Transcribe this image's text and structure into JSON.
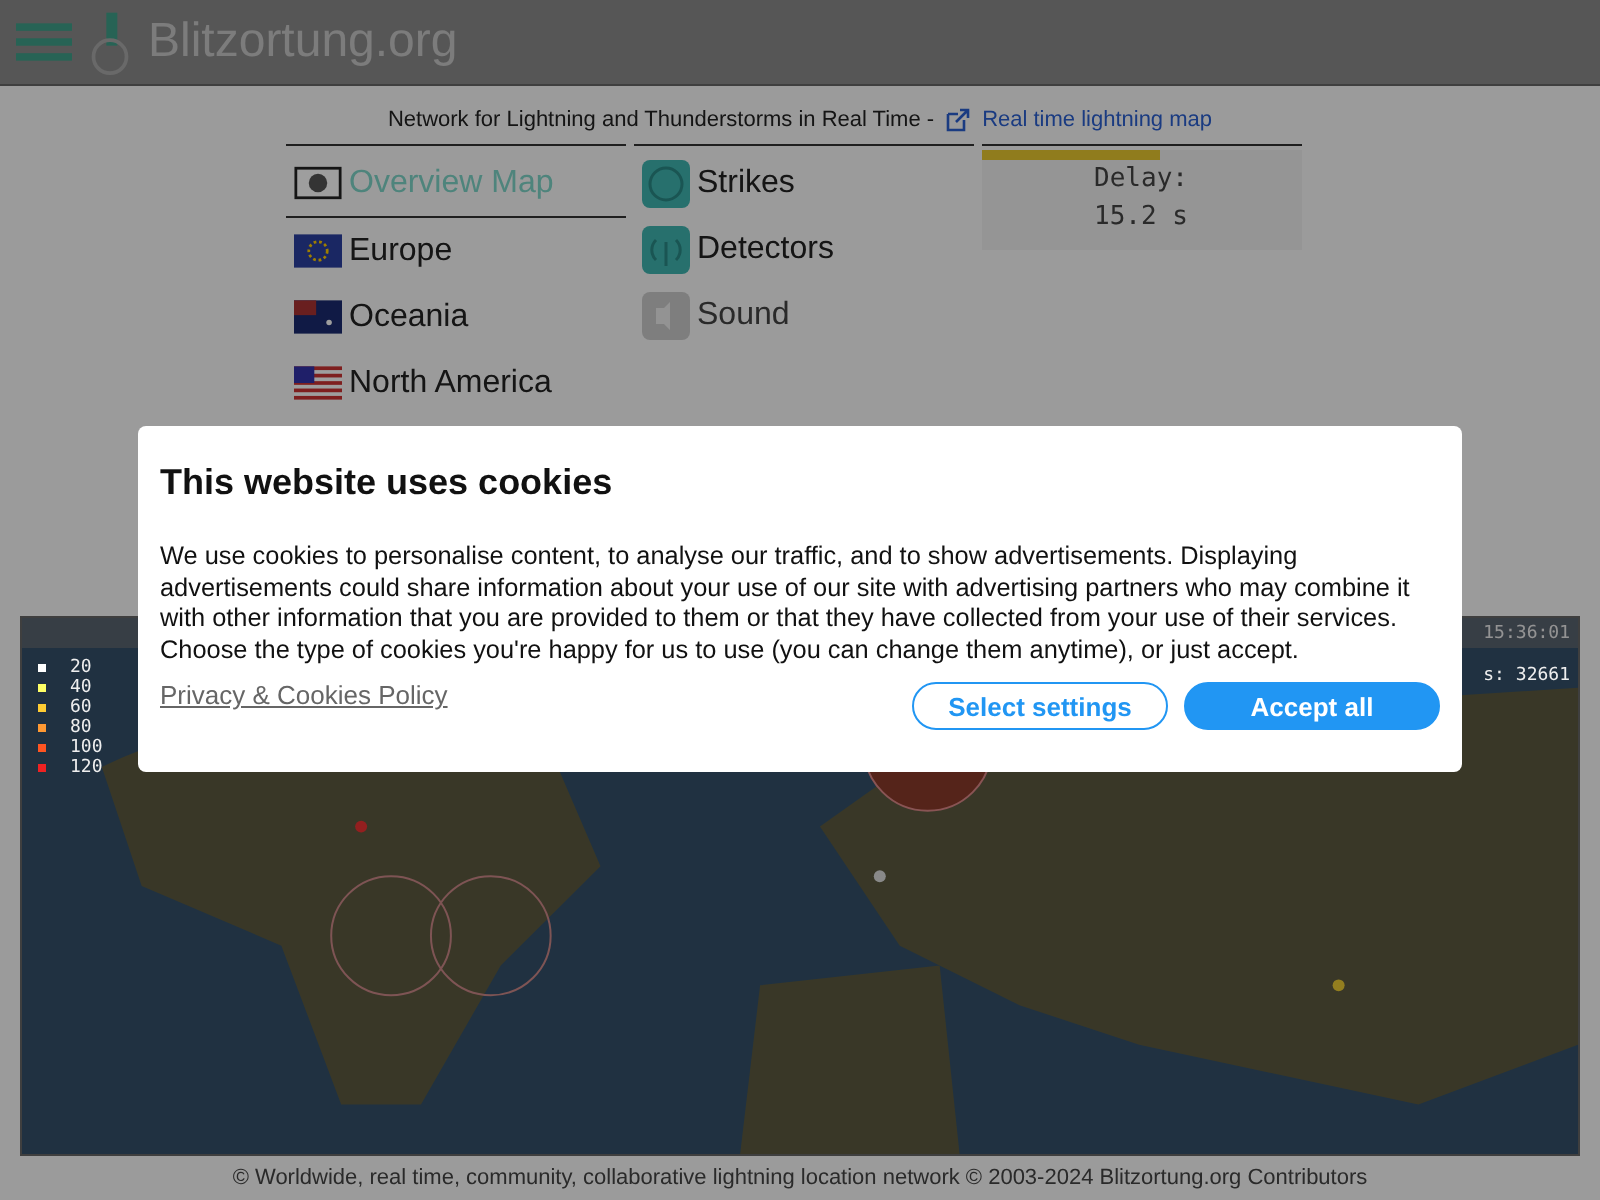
{
  "header": {
    "logo_text": "Blitzortung.org"
  },
  "tagline": {
    "text": "Network for Lightning and Thunderstorms in Real Time -",
    "link": "Real time lightning map"
  },
  "regions": [
    {
      "label": "Overview Map",
      "kind": "globe",
      "selected": true
    },
    {
      "label": "Europe",
      "kind": "eu",
      "selected": false
    },
    {
      "label": "Oceania",
      "kind": "au",
      "selected": false
    },
    {
      "label": "North America",
      "kind": "us",
      "selected": false
    }
  ],
  "features": [
    {
      "label": "Strikes",
      "kind": "strikes",
      "disabled": false
    },
    {
      "label": "Detectors",
      "kind": "detectors",
      "disabled": false
    },
    {
      "label": "Sound",
      "kind": "sound",
      "disabled": true
    }
  ],
  "delay": {
    "label": "Delay:",
    "value": "15.2 s",
    "level": 0.56
  },
  "map": {
    "time": "15:36:01",
    "count": "s: 32661",
    "legend": [
      {
        "label": "20",
        "color": "#ffffff"
      },
      {
        "label": "40",
        "color": "#ffff66"
      },
      {
        "label": "60",
        "color": "#ffcc33"
      },
      {
        "label": "80",
        "color": "#ff9933"
      },
      {
        "label": "100",
        "color": "#ff5522"
      },
      {
        "label": "120",
        "color": "#ee2222"
      }
    ]
  },
  "footer": {
    "text": "© Worldwide, real time, community, collaborative lightning location network © 2003-2024 Blitzortung.org Contributors"
  },
  "cookie_dialog": {
    "title": "This website uses cookies",
    "body": "We use cookies to personalise content, to analyse our traffic, and to show advertisements. Displaying advertisements could share information about your use of our site with advertising partners who may combine it with other information that you are provided to them or that they have collected from your use of their services. Choose the type of cookies you're happy for us to use (you can change them anytime), or just accept.",
    "policy_link": "Privacy & Cookies Policy",
    "buttons": [
      {
        "label": "Select settings",
        "kind": "secondary"
      },
      {
        "label": "Accept all",
        "kind": "primary"
      }
    ]
  }
}
